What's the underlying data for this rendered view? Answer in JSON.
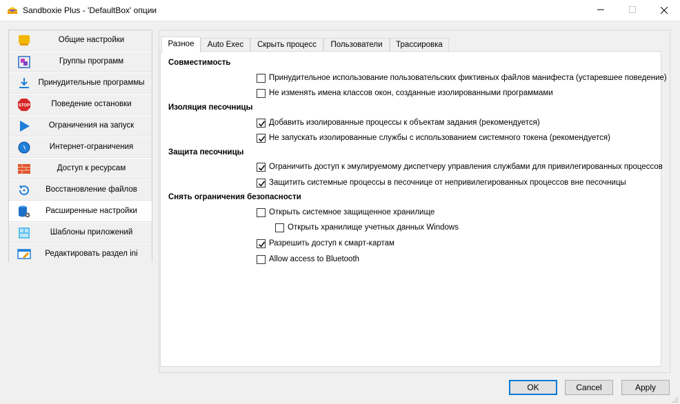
{
  "window": {
    "title": "Sandboxie Plus - 'DefaultBox' опции"
  },
  "sidebar": {
    "items": [
      {
        "label": "Общие настройки",
        "icon": "general-settings-icon",
        "active": false
      },
      {
        "label": "Группы программ",
        "icon": "program-groups-icon",
        "active": false
      },
      {
        "label": "Принудительные программы",
        "icon": "forced-programs-icon",
        "active": false
      },
      {
        "label": "Поведение остановки",
        "icon": "stop-icon",
        "active": false
      },
      {
        "label": "Ограничения на запуск",
        "icon": "play-icon",
        "active": false
      },
      {
        "label": "Интернет-ограничения",
        "icon": "internet-icon",
        "active": false
      },
      {
        "label": "Доступ к ресурсам",
        "icon": "brick-wall-icon",
        "active": false
      },
      {
        "label": "Восстановление файлов",
        "icon": "recovery-icon",
        "active": false
      },
      {
        "label": "Расширенные настройки",
        "icon": "advanced-settings-icon",
        "active": true
      },
      {
        "label": "Шаблоны приложений",
        "icon": "templates-icon",
        "active": false
      },
      {
        "label": "Редактировать раздел ini",
        "icon": "edit-ini-icon",
        "active": false
      }
    ]
  },
  "tabs": [
    {
      "label": "Разное",
      "active": true
    },
    {
      "label": "Auto Exec",
      "active": false
    },
    {
      "label": "Скрыть процесс",
      "active": false
    },
    {
      "label": "Пользователи",
      "active": false
    },
    {
      "label": "Трассировка",
      "active": false
    }
  ],
  "sections": {
    "compat": {
      "title": "Совместимость",
      "options": [
        {
          "label": "Принудительное использование пользовательских фиктивных файлов манифеста (устаревшее поведение)",
          "checked": false
        },
        {
          "label": "Не изменять имена классов окон, созданные изолированными программами",
          "checked": false
        }
      ]
    },
    "isolation": {
      "title": "Изоляция песочницы",
      "options": [
        {
          "label": "Добавить изолированные процессы к объектам задания (рекомендуется)",
          "checked": true
        },
        {
          "label": "Не запускать изолированные службы с использованием системного токена (рекомендуется)",
          "checked": true
        }
      ]
    },
    "protection": {
      "title": "Защита песочницы",
      "options": [
        {
          "label": "Ограничить доступ к эмулируемому диспетчеру управления службами для привилегированных процессов",
          "checked": true
        },
        {
          "label": "Защитить системные процессы в песочнице от непривилегированных процессов вне песочницы",
          "checked": true
        }
      ]
    },
    "security": {
      "title": "Снять ограничения безопасности",
      "options": [
        {
          "label": "Открыть системное защищенное хранилище",
          "checked": false
        },
        {
          "label": "Открыть хранилище учетных данных Windows",
          "checked": false
        },
        {
          "label": "Разрешить доступ к смарт-картам",
          "checked": true
        },
        {
          "label": "Allow access to Bluetooth",
          "checked": false
        }
      ]
    }
  },
  "buttons": {
    "ok": "OK",
    "cancel": "Cancel",
    "apply": "Apply"
  },
  "colors": {
    "accent": "#0078d7",
    "check": "#000000"
  }
}
